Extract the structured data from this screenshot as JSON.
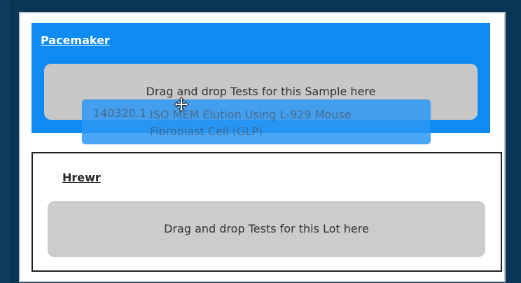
{
  "sample": {
    "title": "Pacemaker",
    "drop_text": "Drag and drop Tests for this Sample here",
    "accent_color": "#0d8bf2"
  },
  "lot": {
    "title": "Hrewr",
    "drop_text": "Drag and drop Tests for this Lot here"
  },
  "dragged_test": {
    "id": "140320.1",
    "name": "ISO MEM Elution Using L-929 Mouse Fibroblast Cell (GLP)"
  },
  "cursor": {
    "icon": "move-cursor-icon"
  }
}
